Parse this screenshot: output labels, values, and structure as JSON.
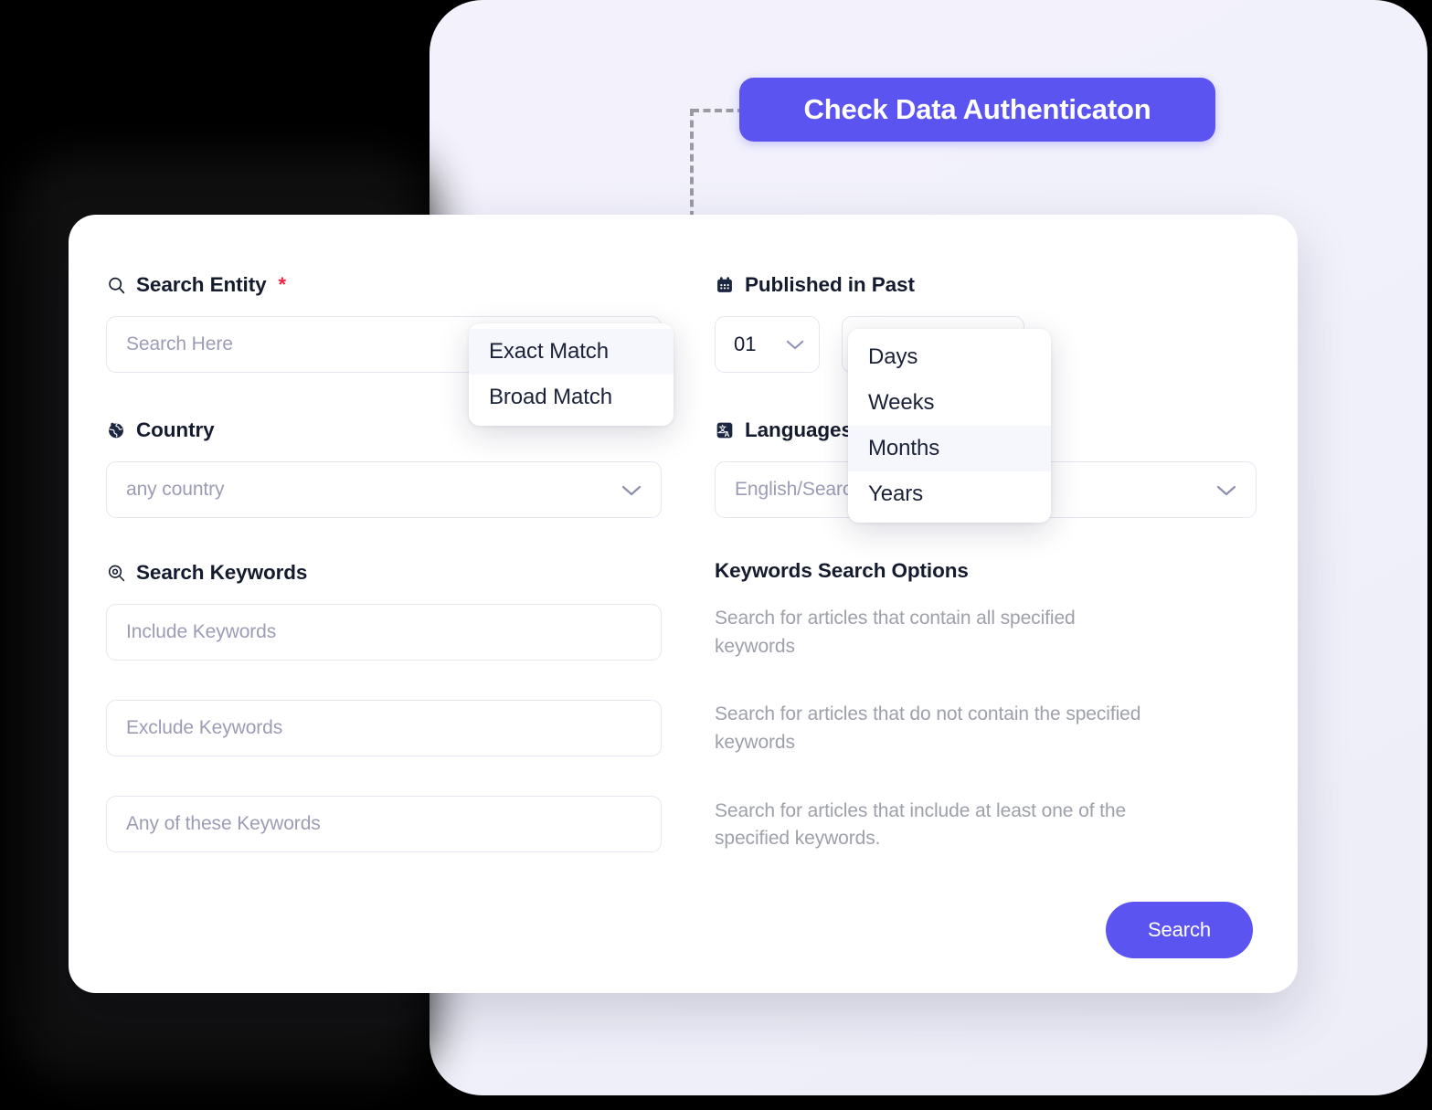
{
  "cta": {
    "label": "Check Data Authenticaton"
  },
  "form": {
    "search_entity": {
      "icon": "search-icon",
      "label": "Search Entity",
      "required_marker": "*",
      "placeholder": "Search Here",
      "match_menu": {
        "items": [
          {
            "label": "Exact Match",
            "active": true
          },
          {
            "label": "Broad Match",
            "active": false
          }
        ]
      }
    },
    "country": {
      "icon": "globe-icon",
      "label": "Country",
      "placeholder": "any country"
    },
    "search_keywords": {
      "icon": "keyword-search-icon",
      "label": "Search Keywords",
      "include_placeholder": "Include Keywords",
      "exclude_placeholder": "Exclude Keywords",
      "any_placeholder": "Any of these Keywords"
    },
    "published_in_past": {
      "icon": "calendar-icon",
      "label": "Published in Past",
      "number_value": "01",
      "unit_menu": {
        "items": [
          {
            "label": "Days",
            "active": false
          },
          {
            "label": "Weeks",
            "active": false
          },
          {
            "label": "Months",
            "active": true
          },
          {
            "label": "Years",
            "active": false
          }
        ]
      }
    },
    "languages": {
      "icon": "translate-icon",
      "label": "Languages",
      "placeholder": "English/Search"
    },
    "keywords_search_options": {
      "title": "Keywords Search Options",
      "descriptions": [
        "Search for articles that contain all specified keywords",
        "Search for articles that do not contain the specified keywords",
        "Search for articles that include at least one of the specified keywords."
      ]
    },
    "submit": {
      "label": "Search"
    }
  },
  "colors": {
    "accent": "#5B54F0",
    "panel_bg": "#F2F1FC",
    "card_bg": "#FFFFFF",
    "text_dark": "#151B2E",
    "text_muted": "#9EA0AA",
    "placeholder": "#9C9CB6",
    "required": "#F3223C",
    "menu_active_bg": "#F6F6FD",
    "border": "#E6E6F0"
  }
}
